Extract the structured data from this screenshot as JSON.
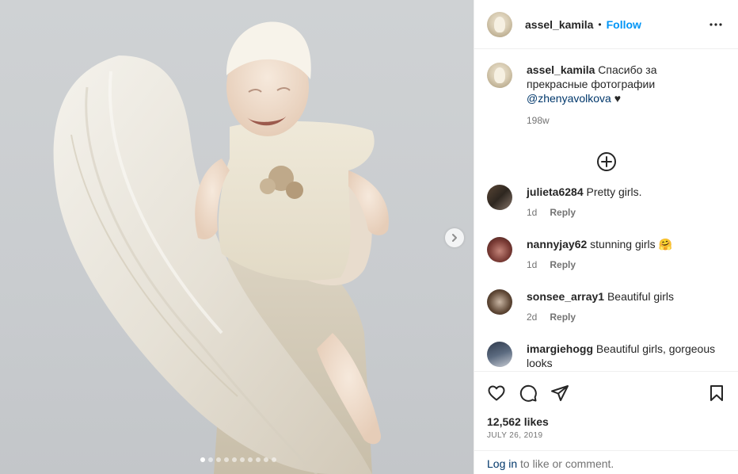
{
  "post": {
    "author": "assel_kamila",
    "separator": "•",
    "follow_label": "Follow",
    "more_icon": "more-horizontal-icon",
    "caption_text": "Спасибо за прекрасные фотографии",
    "caption_mention": "@zhenyavolkova",
    "caption_suffix": " ♥",
    "caption_age": "198w",
    "load_more_icon": "plus-circle-icon"
  },
  "media": {
    "next_icon": "chevron-right-icon",
    "carousel_count": 10,
    "carousel_active": 0
  },
  "comments": [
    {
      "user": "julieta6284",
      "text": "Pretty girls.",
      "age": "1d",
      "reply": "Reply"
    },
    {
      "user": "nannyjay62",
      "text": "stunning girls 🤗",
      "age": "1d",
      "reply": "Reply"
    },
    {
      "user": "sonsee_array1",
      "text": "Beautiful girls",
      "age": "2d",
      "reply": "Reply"
    },
    {
      "user": "imargiehogg",
      "text": "Beautiful girls, gorgeous looks",
      "age": "",
      "reply": ""
    }
  ],
  "actions": {
    "icons": [
      "heart-icon",
      "comment-icon",
      "share-icon",
      "bookmark-icon"
    ]
  },
  "stats": {
    "likes": "12,562 likes",
    "date": "JULY 26, 2019"
  },
  "login": {
    "link": "Log in",
    "rest": " to like or comment."
  },
  "colors": {
    "accent": "#0095f6",
    "link": "#00376b",
    "muted": "#737373",
    "border": "#efefef"
  }
}
